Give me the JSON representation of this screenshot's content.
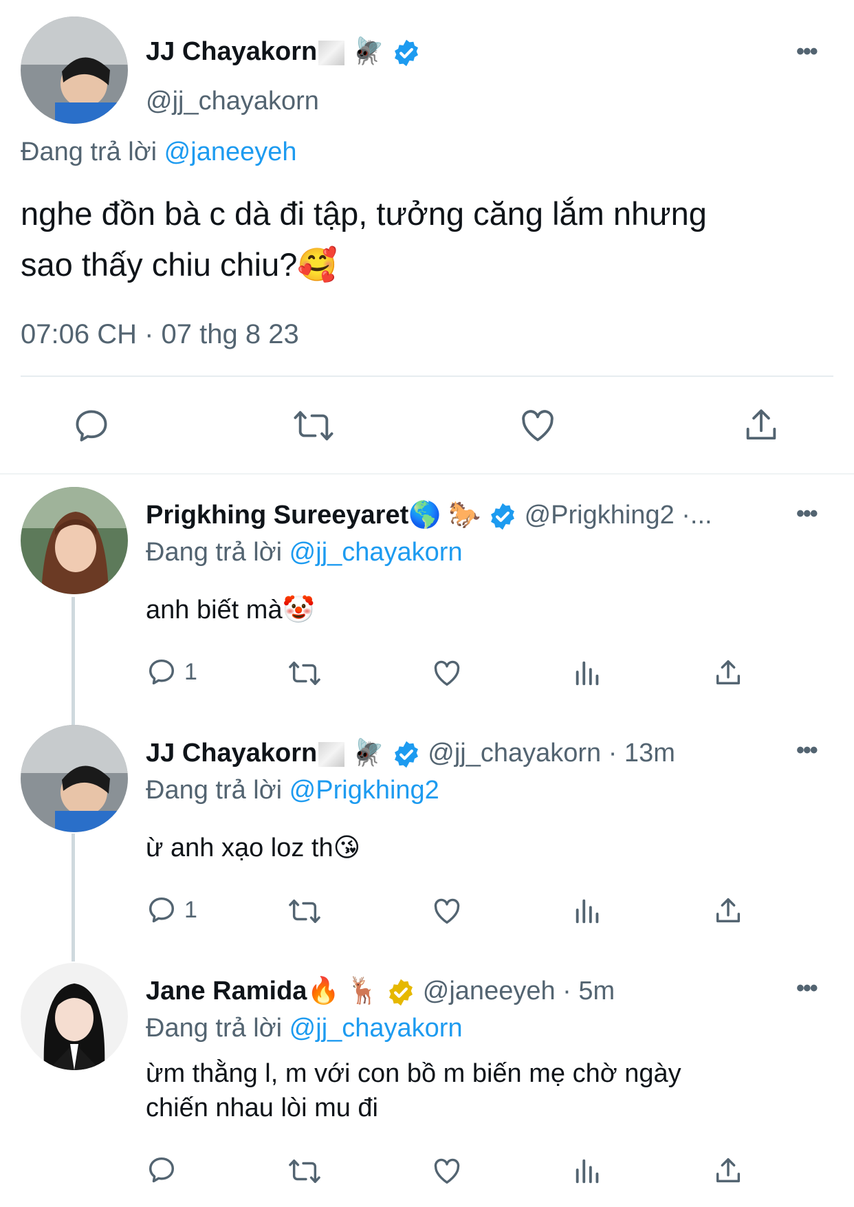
{
  "main_tweet": {
    "display_name": "JJ Chayakorn",
    "name_emoji": "🪰",
    "handle": "@jj_chayakorn",
    "replying_prefix": "Đang trả lời",
    "replying_to": "@janeeyeh",
    "text_line1": "nghe đồn bà c dà đi tập, tưởng căng lắm nhưng",
    "text_line2": "sao thấy chiu chiu?🥰",
    "timestamp": "07:06 CH · 07 thg 8 23"
  },
  "replies": [
    {
      "display_name": "Prigkhing Sureeyaret🌎",
      "name_emoji": "🐎",
      "handle_time": "@Prigkhing2 ·...",
      "replying_prefix": "Đang trả lời",
      "replying_to": "@jj_chayakorn",
      "text_line1": "anh biết mà🤡",
      "text_line2": "",
      "reply_count": "1",
      "verified_color": "#1d9bf0"
    },
    {
      "display_name": "JJ Chayakorn",
      "name_emoji": "🪰",
      "handle_time": "@jj_chayakorn · 13m",
      "replying_prefix": "Đang trả lời",
      "replying_to": "@Prigkhing2",
      "text_line1": "ừ anh xạo loz th😘",
      "text_line2": "",
      "reply_count": "1",
      "verified_color": "#1d9bf0"
    },
    {
      "display_name": "Jane Ramida🔥",
      "name_emoji": "🦌",
      "handle_time": "@janeeyeh · 5m",
      "replying_prefix": "Đang trả lời",
      "replying_to": "@jj_chayakorn",
      "text_line1": "ừm thằng l, m với con bồ m biến mẹ chờ ngày",
      "text_line2": "chiến nhau lòi mu đi",
      "reply_count": "",
      "verified_color": "#e6b800"
    }
  ],
  "more_label": "•••",
  "colors": {
    "link": "#1d9bf0",
    "secondary": "#536471",
    "gold_badge": "#e6b800"
  }
}
